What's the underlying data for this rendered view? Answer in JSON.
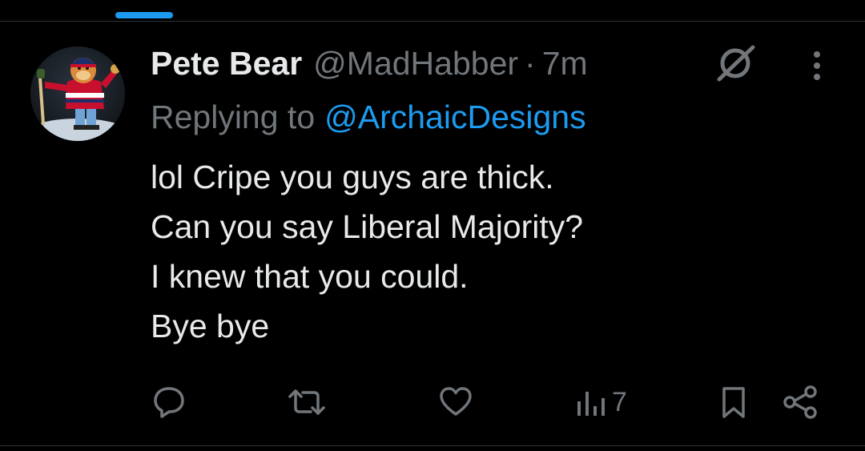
{
  "colors": {
    "background": "#000000",
    "text_primary": "#e7e9ea",
    "text_secondary": "#71767b",
    "accent": "#1d9bf0",
    "divider": "#2f3336"
  },
  "tweet": {
    "author": {
      "display_name": "Pete Bear",
      "handle": "@MadHabber",
      "avatar_icon": "mascot-avatar"
    },
    "separator": "·",
    "time": "7m",
    "replying_prefix": "Replying to",
    "replying_to": "@ArchaicDesigns",
    "body_lines": [
      "lol Cripe you guys are thick.",
      "Can you say Liberal Majority?",
      "I knew that you could.",
      "Bye bye"
    ],
    "actions": {
      "reply_icon": "speech-bubble-icon",
      "retweet_icon": "retweet-arrows-icon",
      "like_icon": "heart-icon",
      "views_icon": "bar-chart-icon",
      "views_count": "7",
      "bookmark_icon": "bookmark-icon",
      "share_icon": "share-nodes-icon"
    },
    "grok_icon": "grok-slash-circle-icon",
    "more_icon": "vertical-ellipsis-icon"
  }
}
